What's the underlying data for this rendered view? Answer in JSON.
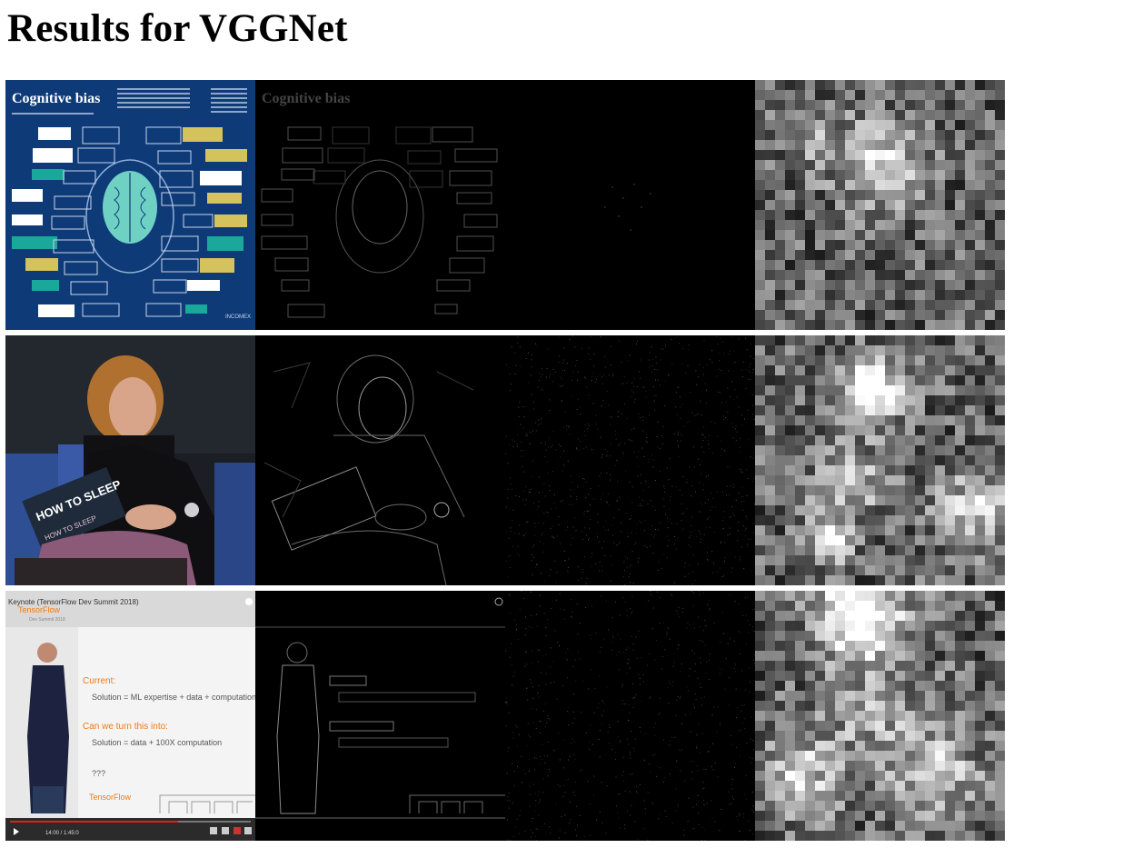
{
  "page": {
    "title": "Results for VGGNet"
  },
  "rows": [
    {
      "input_label": "Cognitive bias",
      "heads": [
        "",
        "",
        "",
        ""
      ]
    },
    {
      "input_label": "HOW TO SLEEP",
      "input_sublabel": "HOW TO SLEEP"
    },
    {
      "input_header": "Keynote (TensorFlow Dev Summit 2018)",
      "brand": "TensorFlow",
      "brand_sub": "Dev Summit 2018",
      "current_label": "Current:",
      "current_line": "Solution = ML expertise + data + computation",
      "question_label": "Can we turn this into:",
      "question_line": "Solution = data + 100X computation",
      "ellipsis": "???",
      "timecode": "14:00 / 1:45:0"
    }
  ]
}
